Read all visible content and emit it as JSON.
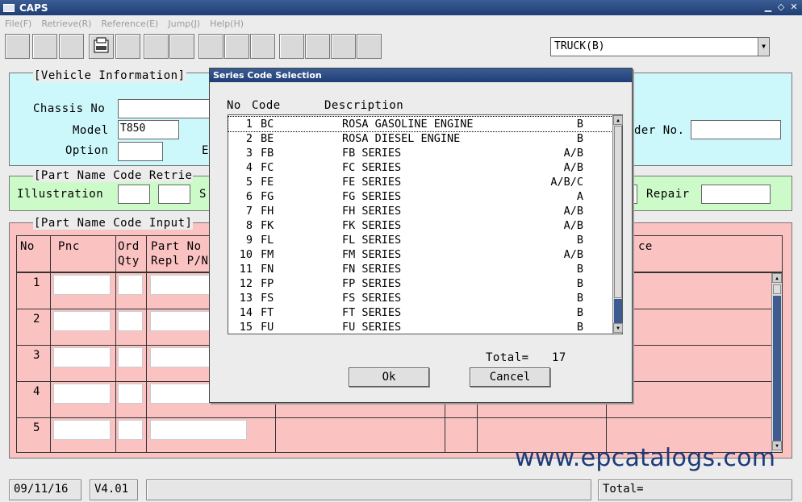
{
  "app": {
    "title": "CAPS"
  },
  "menu": [
    {
      "id": "file",
      "label": "File(F)"
    },
    {
      "id": "retrieve",
      "label": "Retrieve(R)"
    },
    {
      "id": "reference",
      "label": "Reference(E)"
    },
    {
      "id": "jump",
      "label": "Jump(J)"
    },
    {
      "id": "help",
      "label": "Help(H)"
    }
  ],
  "toolbar": {
    "vehicle_select": {
      "value": "TRUCK(B)"
    }
  },
  "vehicle_info": {
    "legend": "[Vehicle Information]",
    "chassis_label": "Chassis No",
    "chassis_value": "",
    "model_label": "Model",
    "model_value": "T850",
    "option_label": "Option",
    "option_value": "",
    "option_trailing": "E",
    "order_label": "der No.",
    "order_value": ""
  },
  "part_retrieval": {
    "legend": "[Part Name Code Retrie",
    "illustration_label": "Illustration",
    "trailing": "S",
    "repair_label": "Repair",
    "repair_value": ""
  },
  "part_input": {
    "legend": "[Part Name Code Input]",
    "headers": {
      "no": "No",
      "pnc": "Pnc",
      "ord": "Ord",
      "qty": "Qty",
      "part_no": "Part No",
      "repl": "Repl P/N",
      "price": "ce"
    },
    "rows": [
      {
        "no": "1"
      },
      {
        "no": "2"
      },
      {
        "no": "3"
      },
      {
        "no": "4"
      },
      {
        "no": "5"
      }
    ]
  },
  "dialog": {
    "title": "Series Code Selection",
    "col_no": "No",
    "col_code": "Code",
    "col_desc": "Description",
    "items": [
      {
        "no": "1",
        "code": "BC",
        "desc": "ROSA GASOLINE ENGINE",
        "type": "B"
      },
      {
        "no": "2",
        "code": "BE",
        "desc": "ROSA DIESEL ENGINE",
        "type": "B"
      },
      {
        "no": "3",
        "code": "FB",
        "desc": "FB SERIES",
        "type": "A/B"
      },
      {
        "no": "4",
        "code": "FC",
        "desc": "FC SERIES",
        "type": "A/B"
      },
      {
        "no": "5",
        "code": "FE",
        "desc": "FE SERIES",
        "type": "A/B/C"
      },
      {
        "no": "6",
        "code": "FG",
        "desc": "FG SERIES",
        "type": "A"
      },
      {
        "no": "7",
        "code": "FH",
        "desc": "FH SERIES",
        "type": "A/B"
      },
      {
        "no": "8",
        "code": "FK",
        "desc": "FK SERIES",
        "type": "A/B"
      },
      {
        "no": "9",
        "code": "FL",
        "desc": "FL SERIES",
        "type": "B"
      },
      {
        "no": "10",
        "code": "FM",
        "desc": "FM SERIES",
        "type": "A/B"
      },
      {
        "no": "11",
        "code": "FN",
        "desc": "FN SERIES",
        "type": "B"
      },
      {
        "no": "12",
        "code": "FP",
        "desc": "FP SERIES",
        "type": "B"
      },
      {
        "no": "13",
        "code": "FS",
        "desc": "FS SERIES",
        "type": "B"
      },
      {
        "no": "14",
        "code": "FT",
        "desc": "FT SERIES",
        "type": "B"
      },
      {
        "no": "15",
        "code": "FU",
        "desc": "FU SERIES",
        "type": "B"
      }
    ],
    "total_label": "Total=",
    "total_value": "17",
    "ok_label": "Ok",
    "cancel_label": "Cancel"
  },
  "status": {
    "date": "09/11/16",
    "version": "V4.01",
    "total_label": "Total="
  },
  "watermark": "www.epcatalogs.com"
}
